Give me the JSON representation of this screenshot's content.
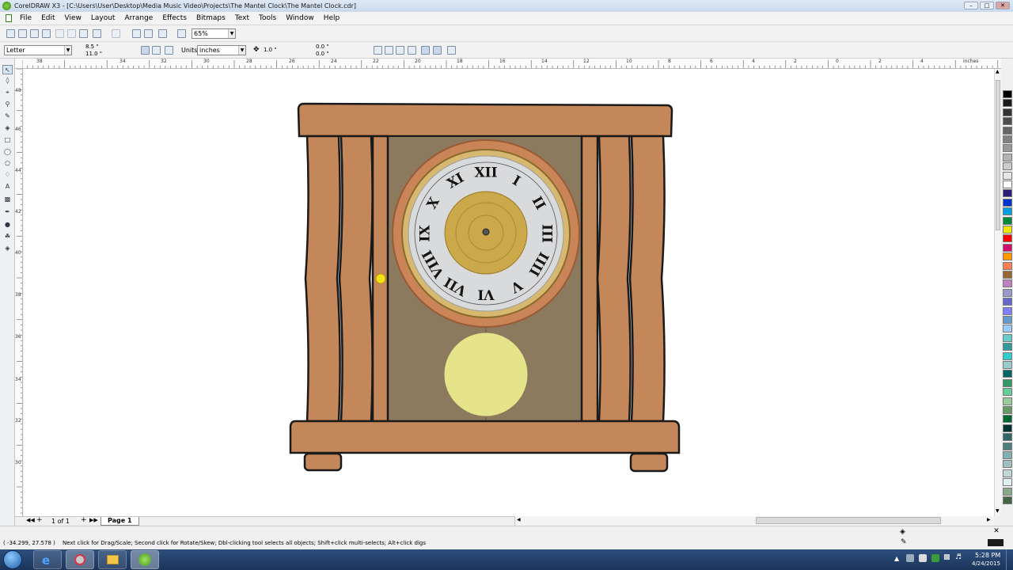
{
  "window": {
    "title": "CorelDRAW X3 - [C:\\Users\\User\\Desktop\\Media Music Video\\Projects\\The Mantel Clock\\The Mantel Clock.cdr]",
    "minimize": "–",
    "maximize": "□",
    "close": "✕"
  },
  "menu": [
    "File",
    "Edit",
    "View",
    "Layout",
    "Arrange",
    "Effects",
    "Bitmaps",
    "Text",
    "Tools",
    "Window",
    "Help"
  ],
  "toolbar": {
    "zoom": "65%"
  },
  "property_bar": {
    "paper_size": "Letter",
    "page_width": "8.5 \"",
    "page_height": "11.0 \"",
    "units_label": "Units:",
    "units_value": "inches",
    "nudge": "1.0 \"",
    "dup_x": "0.0 \"",
    "dup_y": "0.0 \""
  },
  "rulers": {
    "unit": "inches",
    "h_labels": [
      "38",
      "36",
      "34",
      "32",
      "30",
      "28",
      "26",
      "24",
      "22",
      "20",
      "18",
      "16",
      "14",
      "12",
      "10",
      "8",
      "6",
      "4",
      "2",
      "0",
      "2",
      "4"
    ],
    "v_labels": [
      "48",
      "46",
      "44",
      "42",
      "40",
      "38",
      "36",
      "34",
      "32",
      "30"
    ]
  },
  "pages": {
    "counter": "1 of 1",
    "tab": "Page 1"
  },
  "status": {
    "coords": "( -34.299, 27.578 )",
    "hint": "Next click for Drag/Scale; Second click for Rotate/Skew; Dbl-clicking tool selects all objects; Shift+click multi-selects; Alt+click digs"
  },
  "clock": {
    "numerals": [
      "XII",
      "I",
      "II",
      "III",
      "IIII",
      "V",
      "VI",
      "VII",
      "VIII",
      "IX",
      "X",
      "XI"
    ]
  },
  "colors": {
    "wood": "#c4875a",
    "panel": "#8b7a5e",
    "pendulum": "#e6e48a",
    "outline": "#1a1a1a",
    "taskbar": "#1f3c66"
  },
  "palette": [
    "#000000",
    "#1a1a1a",
    "#333333",
    "#4d4d4d",
    "#666666",
    "#808080",
    "#999999",
    "#b3b3b3",
    "#cccccc",
    "#e6e6e6",
    "#ffffff",
    "#2e1f7a",
    "#0033cc",
    "#00a0e0",
    "#008a3c",
    "#f0e600",
    "#ff0000",
    "#d0106f",
    "#ff9900",
    "#ff7f50",
    "#996633",
    "#c080c0",
    "#9999cc",
    "#6666cc",
    "#8080ff",
    "#6699cc",
    "#99ccff",
    "#66cccc",
    "#339999",
    "#33cccc",
    "#99cccc",
    "#006666",
    "#339966",
    "#66cc99",
    "#99cc99",
    "#669966",
    "#006633",
    "#003333",
    "#336666",
    "#4d7f7f",
    "#80b0b0",
    "#a0c0c0",
    "#c0d8d8",
    "#e0f0f0",
    "#88aa88",
    "#446644"
  ],
  "taskbar": {
    "time": "5:28 PM",
    "date": "4/24/2015",
    "apps": [
      "start-button",
      "internet-explorer",
      "coreldraw-alt",
      "file-explorer",
      "coreldraw"
    ]
  }
}
